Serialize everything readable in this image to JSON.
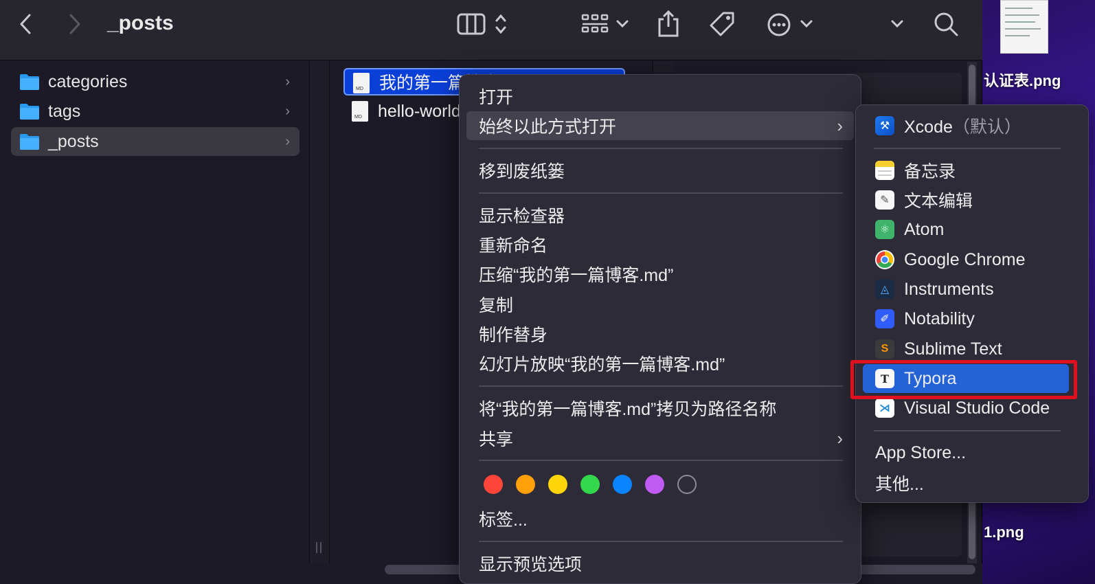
{
  "window": {
    "title": "_posts",
    "toolbar_icons": [
      "back-icon",
      "forward-icon",
      "column-view-icon",
      "group-icon",
      "share-icon",
      "tag-icon",
      "more-icon",
      "expand-icon",
      "search-icon"
    ]
  },
  "sidebar": {
    "items": [
      {
        "label": "categories"
      },
      {
        "label": "tags"
      },
      {
        "label": "_posts"
      }
    ]
  },
  "files": [
    {
      "name": "我的第一篇博客.md"
    },
    {
      "name": "hello-world.md"
    }
  ],
  "desktop": {
    "labels": [
      "认证表.png",
      "1.png"
    ]
  },
  "context_menu": {
    "open": "打开",
    "open_with": "始终以此方式打开",
    "trash": "移到废纸篓",
    "inspector": "显示检查器",
    "rename": "重新命名",
    "compress": "压缩“我的第一篇博客.md”",
    "copy": "复制",
    "alias": "制作替身",
    "slideshow": "幻灯片放映“我的第一篇博客.md”",
    "copy_path": "将“我的第一篇博客.md”拷贝为路径名称",
    "share": "共享",
    "tags_label": "标签...",
    "preview_options": "显示预览选项",
    "tag_colors": [
      "#ff453a",
      "#ff9f0a",
      "#ffd60a",
      "#32d74b",
      "#0a84ff",
      "#bf5af2"
    ]
  },
  "submenu": {
    "default_app": "Xcode",
    "default_suffix": "（默认）",
    "apps": [
      "备忘录",
      "文本编辑",
      "Atom",
      "Google Chrome",
      "Instruments",
      "Notability",
      "Sublime Text",
      "Typora",
      "Visual Studio Code"
    ],
    "app_store": "App Store...",
    "other": "其他...",
    "highlighted": "Typora"
  }
}
